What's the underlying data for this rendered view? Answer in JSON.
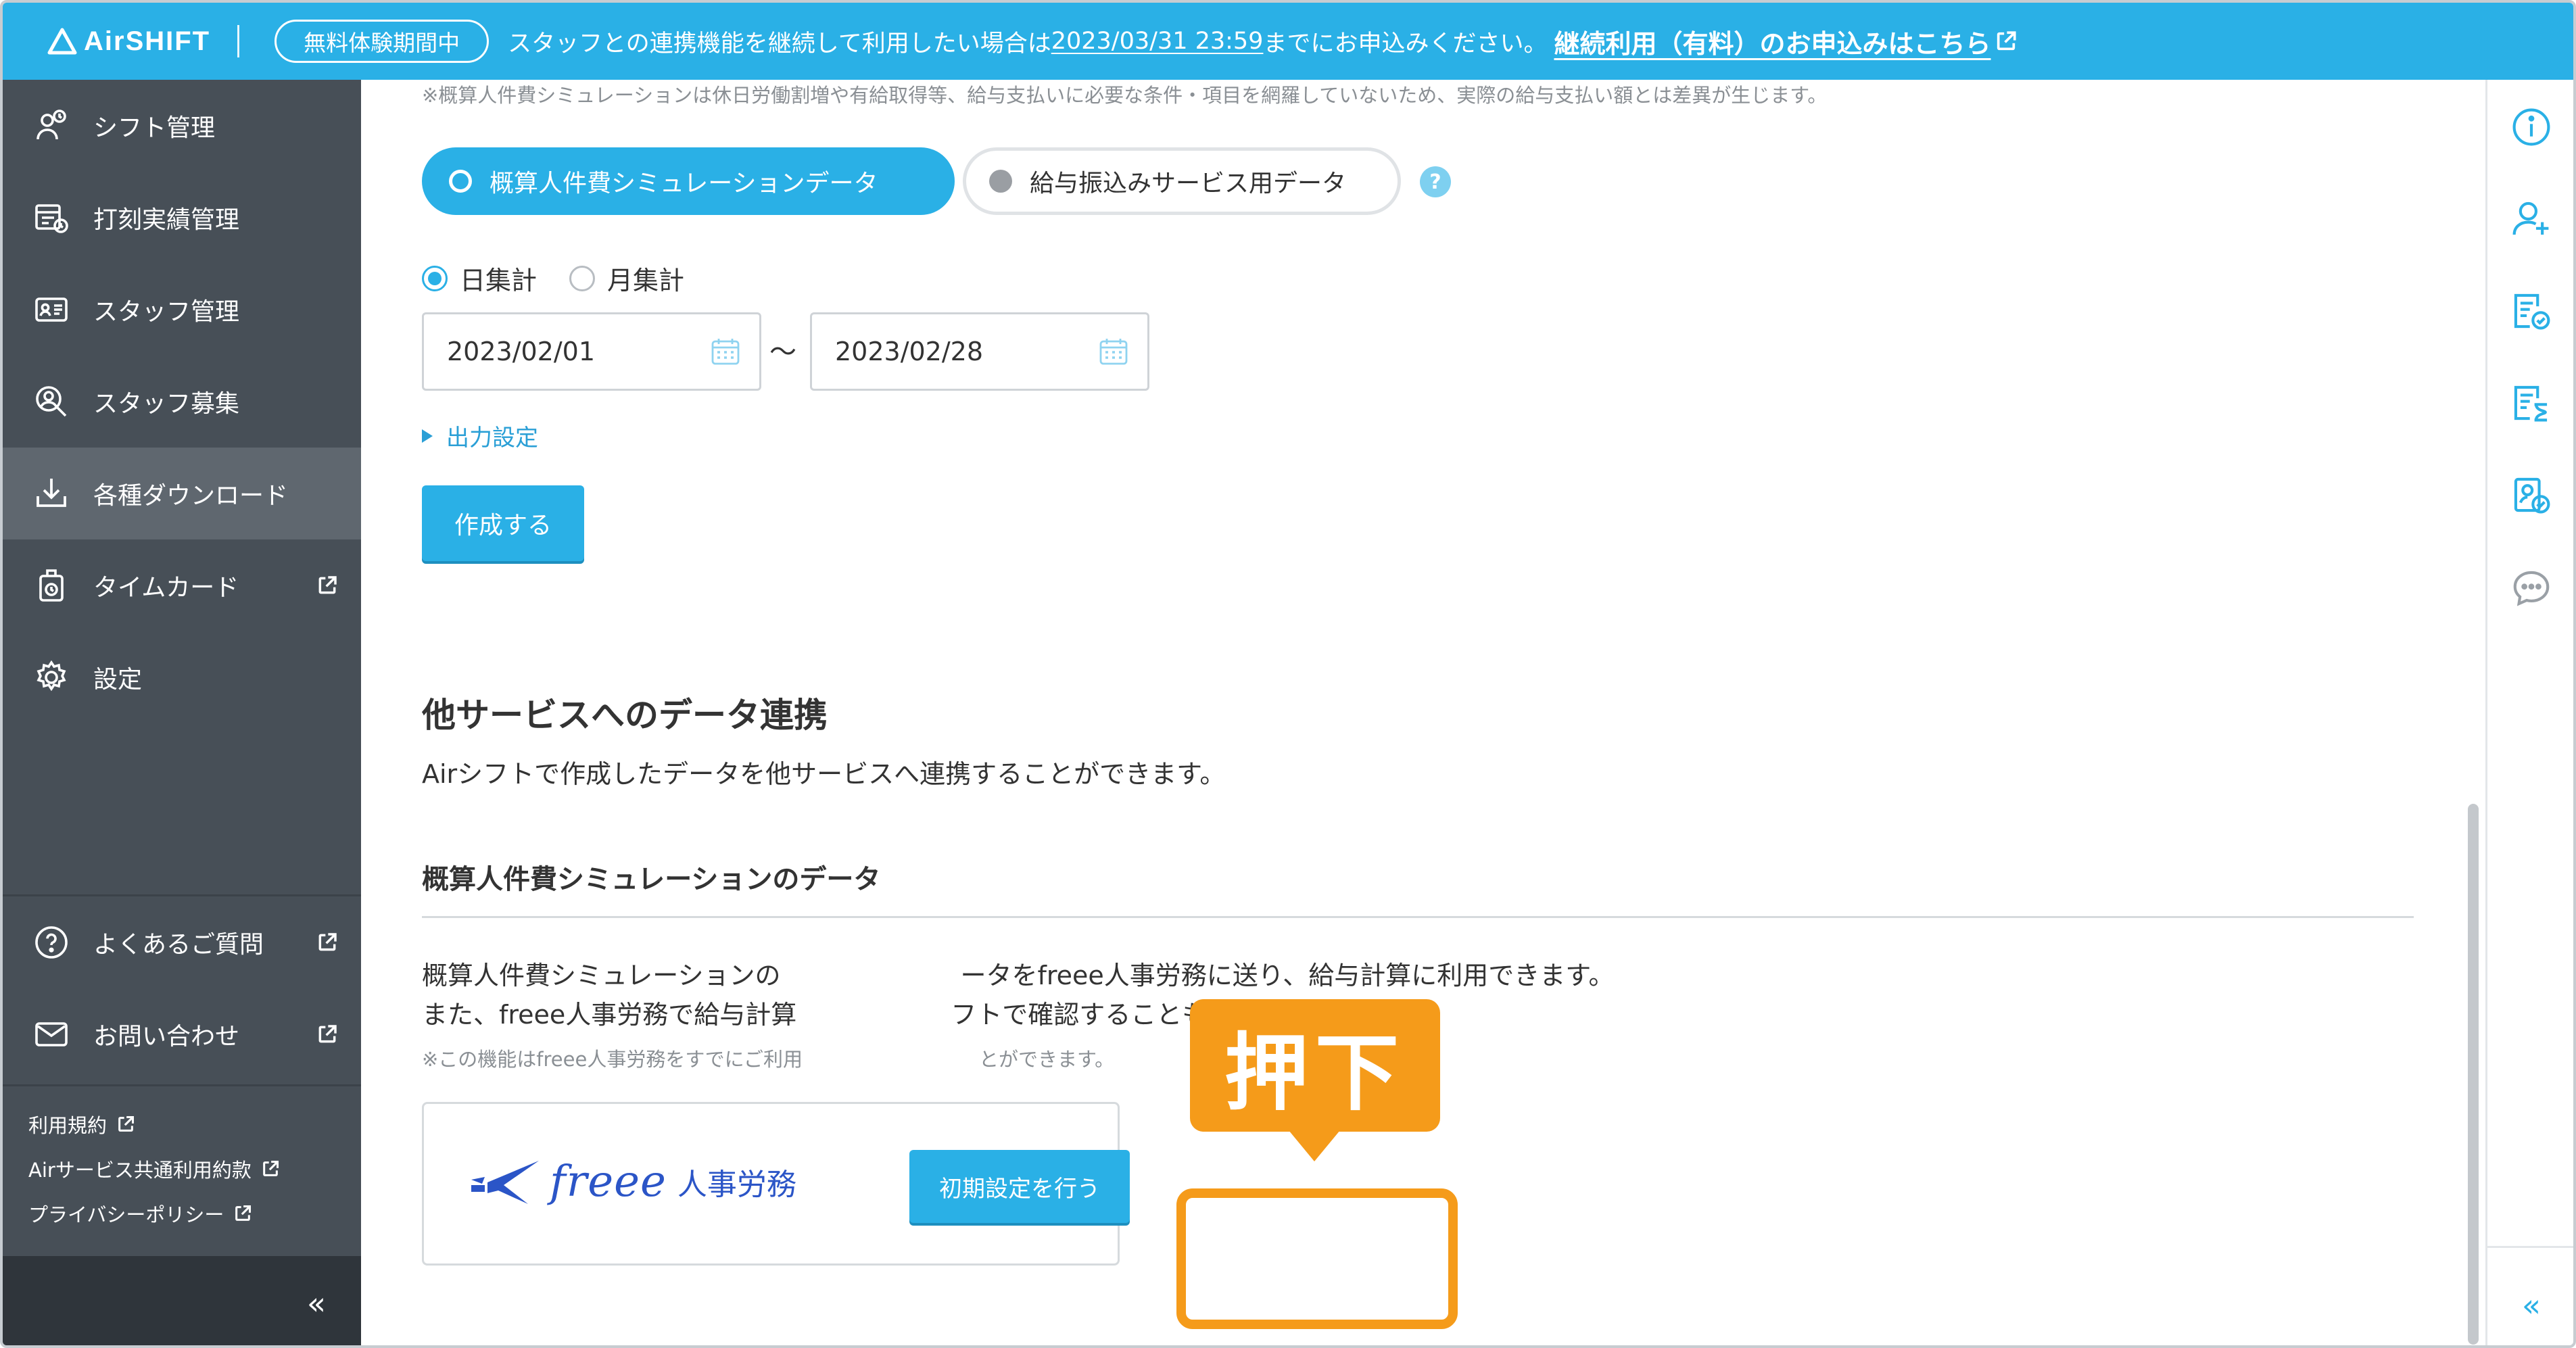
{
  "colors": {
    "brand": "#2ab0e6",
    "sidebar": "#474f57",
    "sidebar_active": "#5f676f",
    "callout": "#f59b1a",
    "freee": "#2b55c7"
  },
  "banner": {
    "logo": "AirSHIFT",
    "trial_badge": "無料体験期間中",
    "message_before": "スタッフとの連携機能を継続して利用したい場合は",
    "deadline": "2023/03/31 23:59",
    "message_after": "までにお申込みください。",
    "cta": "継続利用（有料）のお申込みはこちら",
    "cta_icon": "external-link-icon"
  },
  "sidebar": {
    "items": [
      {
        "label": "シフト管理",
        "icon": "shift-icon"
      },
      {
        "label": "打刻実績管理",
        "icon": "timeclock-icon"
      },
      {
        "label": "スタッフ管理",
        "icon": "staff-card-icon"
      },
      {
        "label": "スタッフ募集",
        "icon": "recruit-icon"
      },
      {
        "label": "各種ダウンロード",
        "icon": "download-icon"
      },
      {
        "label": "タイムカード",
        "icon": "timecard-icon"
      },
      {
        "label": "設定",
        "icon": "gear-icon"
      }
    ],
    "bottom_items": [
      {
        "label": "よくあるご質問",
        "icon": "question-icon"
      },
      {
        "label": "お問い合わせ",
        "icon": "mail-icon"
      }
    ],
    "links": [
      "利用規約",
      "Airサービス共通利用約款",
      "プライバシーポリシー"
    ],
    "collapse": "«"
  },
  "rail": {
    "icons": [
      "info-icon",
      "add-user-icon",
      "checklist-icon",
      "hourglass-list-icon",
      "staff-check-icon",
      "chat-icon"
    ],
    "collapse": "«"
  },
  "main": {
    "note_top": "※概算人件費シミュレーションは休日労働割増や有給取得等、給与支払いに必要な条件・項目を網羅していないため、実際の給与支払い額とは差異が生じます。",
    "toggle_primary": "概算人件費シミュレーションデータ",
    "toggle_secondary": "給与振込みサービス用データ",
    "help": "?",
    "radio_daily": "日集計",
    "radio_monthly": "月集計",
    "date_from": "2023/02/01",
    "tilde": "〜",
    "date_to": "2023/02/28",
    "output_settings": "出力設定",
    "create_button": "作成する",
    "section_title": "他サービスへのデータ連携",
    "section_desc": "Airシフトで作成したデータを他サービスへ連携することができます。",
    "sub_title": "概算人件費シミュレーションのデータ",
    "body_line1": "概算人件費シミュレーションの　　　　　　　ータをfreee人事労務に送り、給与計算に利用できます。",
    "body_line2": "また、freee人事労務で給与計算　　　　　　フトで確認することもできます。",
    "note_small": "※この機能はfreee人事労務をすでにご利用　　　　　　　　　とができます。",
    "freee_word": "freee",
    "freee_product": "人事労務",
    "init_button": "初期設定を行う"
  },
  "callout": {
    "label": "押下"
  }
}
